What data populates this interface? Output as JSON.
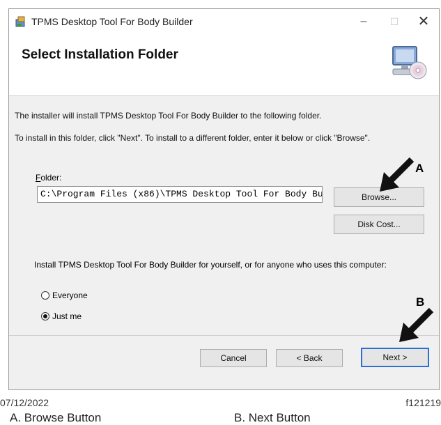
{
  "window": {
    "title": "TPMS Desktop Tool For Body Builder",
    "minimize_glyph": "–",
    "maximize_glyph": "☐",
    "close_glyph": "✕",
    "app_icon": "installer-icon"
  },
  "header": {
    "heading": "Select Installation Folder",
    "icon": "computer-cd-icon"
  },
  "body": {
    "line1": "The installer will install TPMS Desktop Tool For Body Builder to the following folder.",
    "line2": "To install in this folder, click \"Next\". To install to a different folder, enter it below or click \"Browse\".",
    "folder_label_accel": "F",
    "folder_label_rest": "older:",
    "folder_value": "C:\\Program Files (x86)\\TPMS Desktop Tool For Body Bu",
    "browse_label": "Browse...",
    "diskcost_label": "Disk Cost...",
    "install_for_text": "Install TPMS Desktop Tool For Body Builder for yourself, or for anyone who uses this computer:",
    "options": [
      {
        "label": "Everyone",
        "selected": false
      },
      {
        "label": "Just me",
        "selected": true
      }
    ]
  },
  "footer": {
    "cancel_label": "Cancel",
    "back_label": "< Back",
    "next_label": "Next >"
  },
  "annotations": {
    "marker_a": "A",
    "marker_b": "B"
  },
  "document": {
    "date": "07/12/2022",
    "figure_id": "f121219",
    "caption_a": "A.  Browse Button",
    "caption_b": "B.  Next Button"
  }
}
